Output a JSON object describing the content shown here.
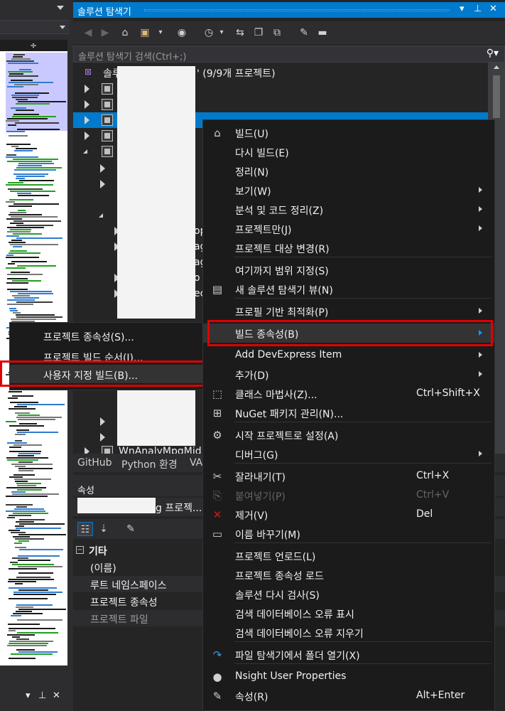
{
  "solution_explorer": {
    "title": "솔루션 탐색기",
    "title_controls": [
      "▾",
      "⊥",
      "✕"
    ],
    "search_placeholder": "솔루션 탐색기 검색(Ctrl+;)",
    "solution_label_prefix": "솔루션",
    "solution_label_suffix": "' (9/9개 프로젝트)",
    "bottom_tabs": [
      "GitHub",
      "Python 환경",
      "VA"
    ],
    "partial_labels": [
      "op",
      "ag",
      "ag",
      "o",
      "ec"
    ],
    "bottom_project_label": "WnAnalyMpgMid"
  },
  "properties": {
    "title": "속성",
    "object_suffix": "g 프로젝...",
    "category": "기타",
    "rows": [
      "(이름)",
      "루트 네임스페이스",
      "프로젝트 종속성",
      "프로젝트 파일"
    ]
  },
  "submenu": {
    "items": [
      {
        "label": "프로젝트 종속성(S)..."
      },
      {
        "label": "프로젝트 빌드 순서(I)..."
      },
      {
        "label": "사용자 지정 빌드(B)..."
      }
    ]
  },
  "context_menu": {
    "items": [
      {
        "label": "빌드(U)",
        "icon": "build-icon"
      },
      {
        "label": "다시 빌드(E)"
      },
      {
        "label": "정리(N)"
      },
      {
        "label": "보기(W)",
        "submenu": true
      },
      {
        "label": "분석 및 코드 정리(Z)",
        "submenu": true
      },
      {
        "label": "프로젝트만(J)",
        "submenu": true
      },
      {
        "label": "프로젝트 대상 변경(R)"
      },
      {
        "label": "여기까지 범위 지정(S)"
      },
      {
        "label": "새 솔루션 탐색기 뷰(N)",
        "icon": "new-view-icon"
      },
      {
        "label": "프로필 기반 최적화(P)",
        "submenu": true
      },
      {
        "label": "빌드 종속성(B)",
        "submenu": true,
        "highlight": true
      },
      {
        "label": "Add DevExpress Item",
        "submenu": true
      },
      {
        "label": "추가(D)",
        "submenu": true
      },
      {
        "label": "클래스 마법사(Z)...",
        "shortcut": "Ctrl+Shift+X",
        "icon": "class-wizard-icon"
      },
      {
        "label": "NuGet 패키지 관리(N)...",
        "icon": "nuget-icon"
      },
      {
        "label": "시작 프로젝트로 설정(A)",
        "icon": "gear-icon"
      },
      {
        "label": "디버그(G)",
        "submenu": true
      },
      {
        "label": "잘라내기(T)",
        "shortcut": "Ctrl+X",
        "icon": "scissors-icon"
      },
      {
        "label": "붙여넣기(P)",
        "shortcut": "Ctrl+V",
        "icon": "paste-icon",
        "disabled": true
      },
      {
        "label": "제거(V)",
        "shortcut": "Del",
        "icon": "remove-icon"
      },
      {
        "label": "이름 바꾸기(M)",
        "icon": "rename-icon"
      },
      {
        "label": "프로젝트 언로드(L)"
      },
      {
        "label": "프로젝트 종속성 로드"
      },
      {
        "label": "솔루션 다시 검사(S)"
      },
      {
        "label": "검색 데이터베이스 오류 표시"
      },
      {
        "label": "검색 데이터베이스 오류 지우기"
      },
      {
        "label": "파일 탐색기에서 폴더 열기(X)",
        "icon": "open-folder-icon"
      },
      {
        "label": "Nsight User Properties",
        "icon": "nsight-icon"
      },
      {
        "label": "속성(R)",
        "shortcut": "Alt+Enter",
        "icon": "wrench-icon"
      }
    ]
  },
  "colors": {
    "accent": "#007acc",
    "highlight_border": "#e00000",
    "menu_bg": "#1b1b1c"
  }
}
